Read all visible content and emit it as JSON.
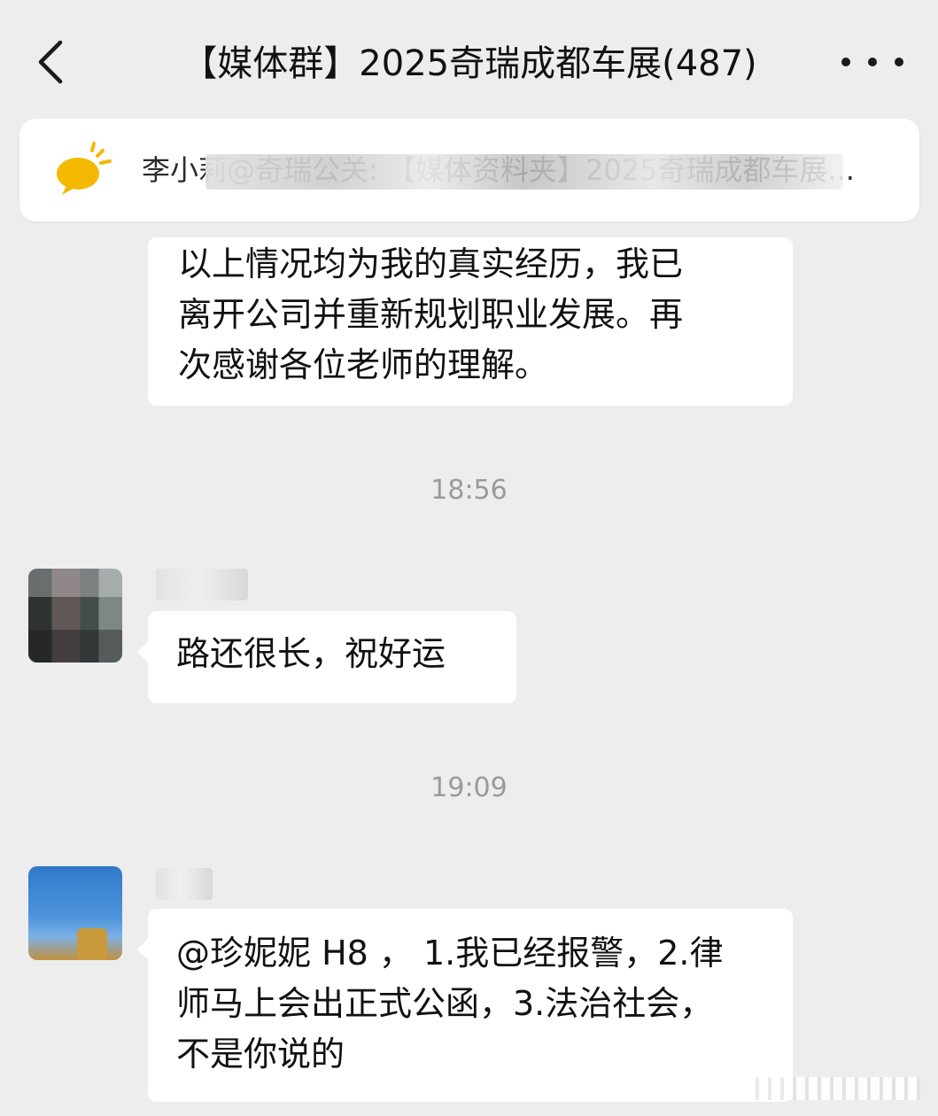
{
  "header": {
    "title": "【媒体群】2025奇瑞成都车展(487)"
  },
  "pinned": {
    "text": "李小莉@奇瑞公关: 【媒体资料夹】2025奇瑞成都车展..."
  },
  "messages": [
    {
      "lines": [
        "以上情况均为我的真实经历，我已",
        "离开公司并重新规划职业发展。再",
        "次感谢各位老师的理解。"
      ]
    },
    {
      "timestamp": "18:56",
      "lines": [
        "路还很长，祝好运"
      ]
    },
    {
      "timestamp": "19:09",
      "lines": [
        "@珍妮妮 H8 ， 1.我已经报警，2.律",
        "师马上会出正式公函，3.法治社会，",
        "不是你说的"
      ]
    }
  ],
  "colors": {
    "background": "#ededed",
    "bubble": "#ffffff",
    "timestamp": "#9a9a9a",
    "pin_icon": "#f5b800"
  },
  "icons": {
    "back": "chevron-left-icon",
    "more": "more-dots-icon",
    "pinned": "speech-bubble-icon"
  }
}
